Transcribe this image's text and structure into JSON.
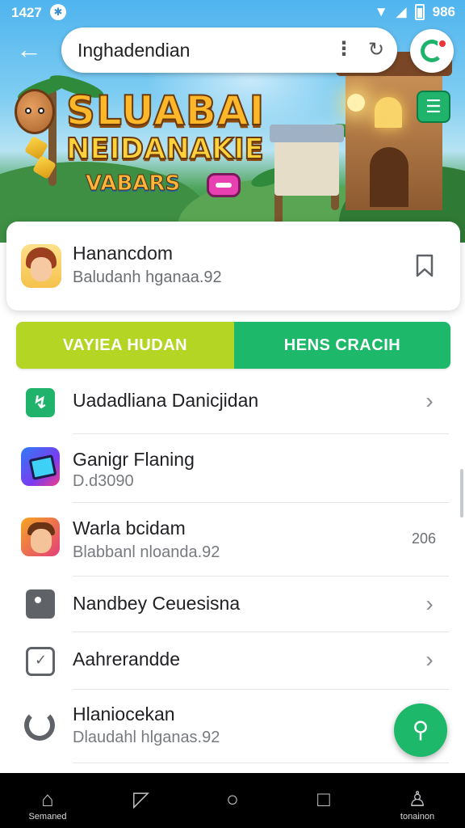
{
  "status_bar": {
    "time": "1427",
    "battery": "986"
  },
  "search": {
    "query": "Inghadendian"
  },
  "banner": {
    "title": "SLUABAI",
    "subtitle": "NEIDANAKIE",
    "tag": "VABARS"
  },
  "app": {
    "name": "Hanancdom",
    "subtitle": "Baludanh hganaa.92"
  },
  "actions": {
    "primary": "VAYIEA HUDAN",
    "secondary": "HENS CRACIH"
  },
  "list": [
    {
      "label": "Uadadliana Danicjidan",
      "icon": "trending-icon"
    },
    {
      "label": "Ganigr Flaning",
      "sub": "D.d3090",
      "icon": "game-app-icon"
    },
    {
      "label": "Warla bcidam",
      "sub": "Blabbanl nloanda.92",
      "meta": "206",
      "icon": "character-app-icon"
    },
    {
      "label": "Nandbey Ceuesisna",
      "icon": "camera-icon"
    },
    {
      "label": "Aahrerandde",
      "icon": "tag-check-icon"
    },
    {
      "label": "Hlaniocekan",
      "sub": "Dlaudahl hlganas.92",
      "icon": "refresh-icon"
    }
  ],
  "bottom_nav": [
    {
      "label": "Semaned",
      "icon": "home-icon"
    },
    {
      "label": "",
      "icon": "back-icon"
    },
    {
      "label": "",
      "icon": "circle-home-icon"
    },
    {
      "label": "",
      "icon": "square-recents-icon"
    },
    {
      "label": "tonainon",
      "icon": "profile-icon"
    }
  ],
  "colors": {
    "primary_green": "#1db86a",
    "lime": "#b4d523"
  }
}
